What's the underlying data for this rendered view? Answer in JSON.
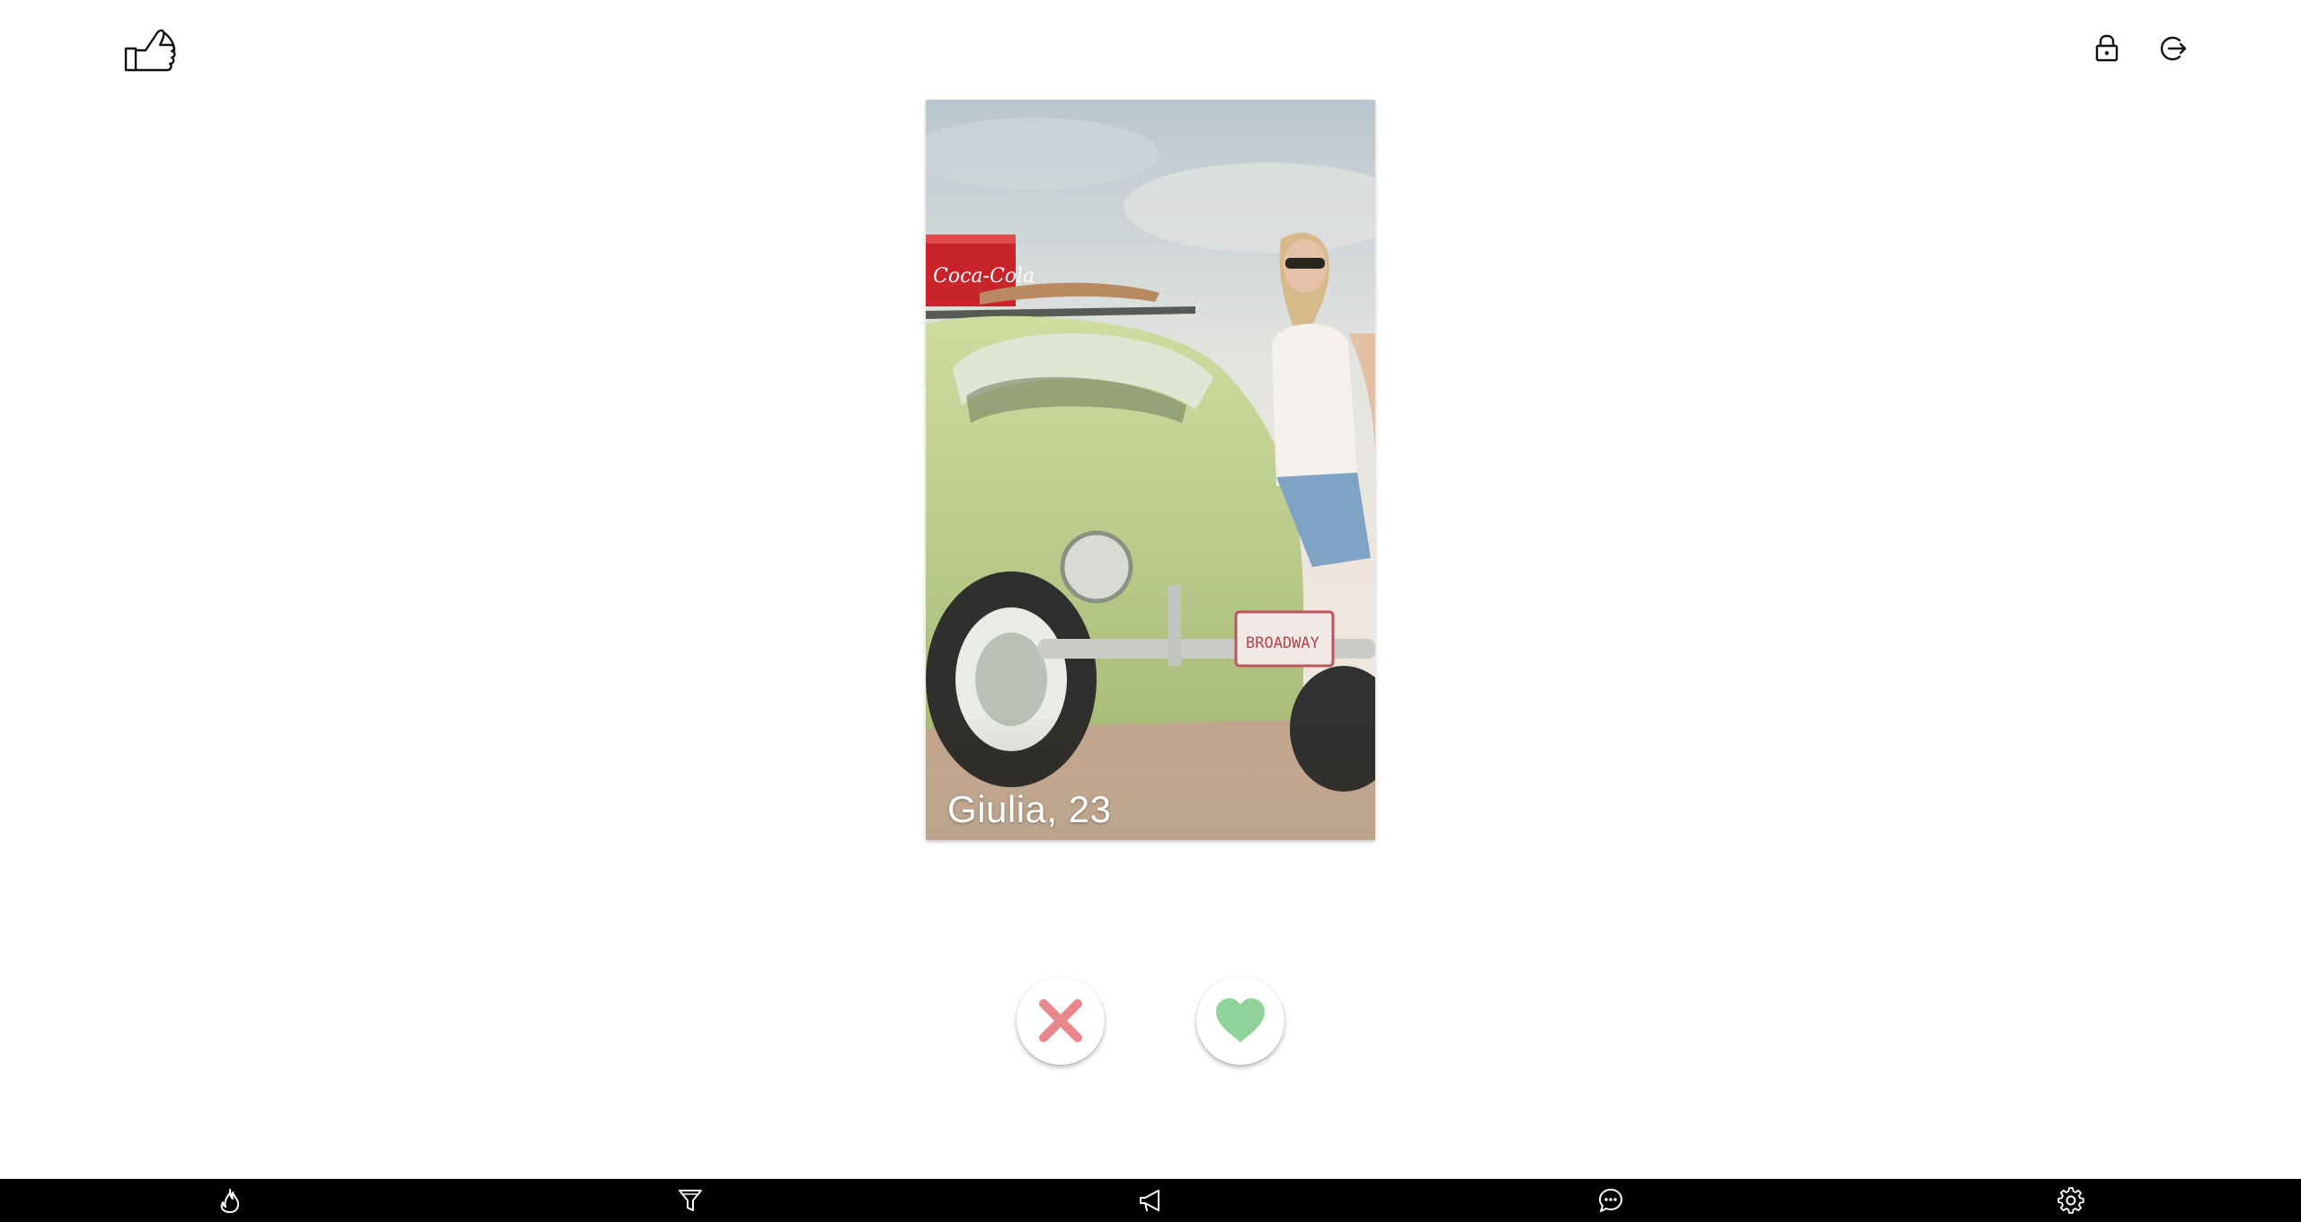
{
  "app": {
    "logo_icon": "hand-gesture-icon",
    "header_actions": [
      {
        "icon": "lock-icon"
      },
      {
        "icon": "logout-icon"
      }
    ]
  },
  "profile": {
    "name_age": "Giulia, 23"
  },
  "actions": {
    "dislike": {
      "icon": "x-icon",
      "color": "#e8878b"
    },
    "like": {
      "icon": "heart-icon",
      "color": "#8fd29a"
    }
  },
  "bottom_nav": {
    "items": [
      {
        "icon": "flame-icon"
      },
      {
        "icon": "filter-icon"
      },
      {
        "icon": "megaphone-icon"
      },
      {
        "icon": "chat-icon"
      },
      {
        "icon": "gear-icon"
      }
    ]
  },
  "colors": {
    "background": "#ffffff",
    "nav_background": "#000000",
    "nav_icon": "#ffffff"
  }
}
